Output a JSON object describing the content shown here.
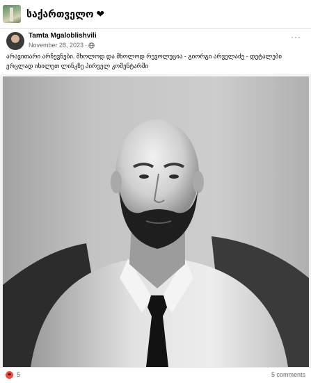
{
  "group": {
    "name": "საქართველო ❤",
    "thumb_icon": "group-photo"
  },
  "post": {
    "author": "Tamta Mgaloblishvili",
    "date": "November 28, 2023",
    "date_separator": "·",
    "privacy_icon": "globe-icon",
    "more_icon": "···",
    "caption": "არავითარი არჩევნები. მხოლოდ და მხოლოდ რევოლუცია - გიორგი არველაძე - დეტალები ვრცლად იხილეთ ლინკზე პირველ კომენტარში"
  },
  "footer": {
    "reaction_icon": "angry-reaction-icon",
    "reaction_count": "5",
    "comments_label": "5 comments"
  },
  "colors": {
    "text_primary": "#050505",
    "text_secondary": "#65676b",
    "background": "#f0f2f5",
    "card": "#ffffff",
    "reaction": "#f04a3a"
  }
}
